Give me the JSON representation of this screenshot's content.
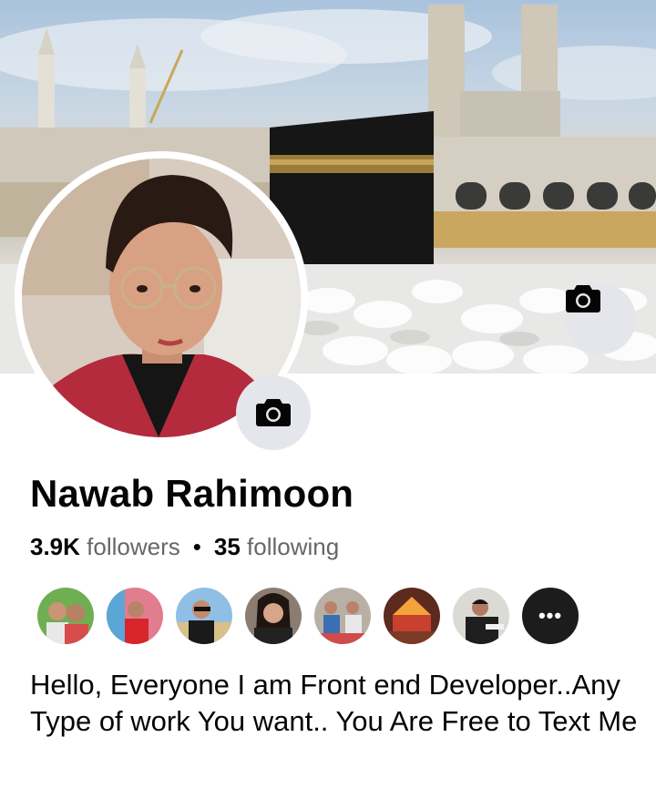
{
  "profile": {
    "name": "Nawab Rahimoon",
    "followers_count": "3.9K",
    "followers_label": "followers",
    "separator": "•",
    "following_count": "35",
    "following_label": "following",
    "bio": "Hello, Everyone I am Front end Developer..Any Type of work You want.. You Are Free to Text Me"
  },
  "friends": {
    "more_label": "•••",
    "count_visible": 8
  },
  "icons": {
    "cover_camera": "camera-icon",
    "avatar_camera": "camera-icon"
  },
  "colors": {
    "text_primary": "#050505",
    "text_secondary": "#65676b",
    "button_bg": "#e4e6eb"
  }
}
